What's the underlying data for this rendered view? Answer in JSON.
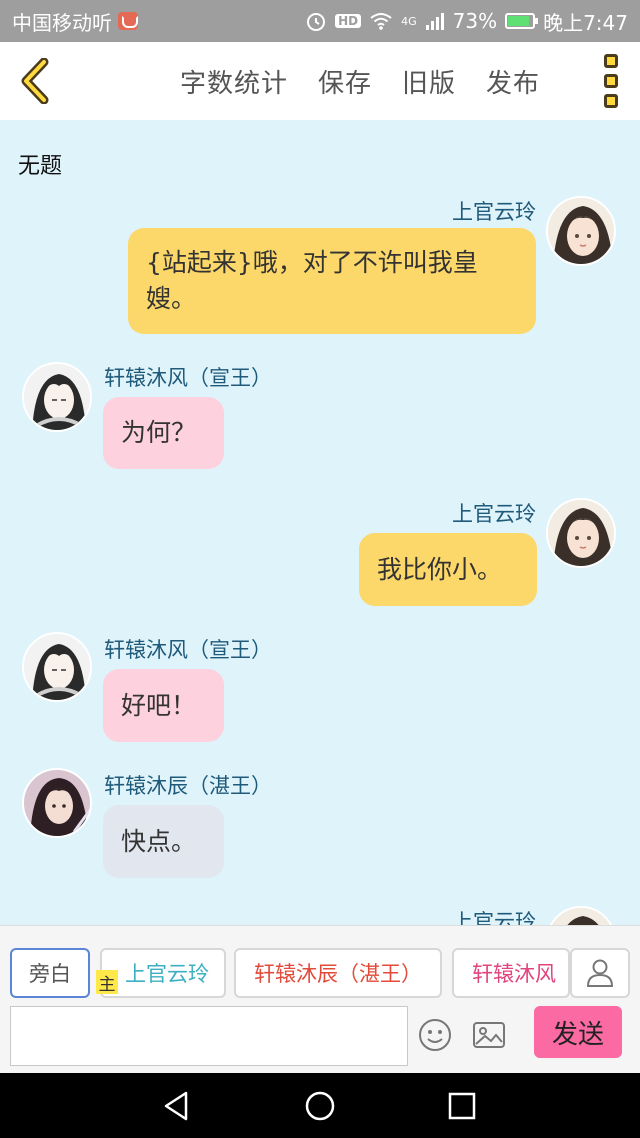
{
  "status_bar": {
    "carrier": "中国移动听",
    "hd": "HD",
    "network": "4G",
    "battery": "73%",
    "time": "晚上7:47"
  },
  "nav": {
    "items": [
      "字数统计",
      "保存",
      "旧版",
      "发布"
    ]
  },
  "chat": {
    "title": "无题",
    "messages": [
      {
        "speaker": "上官云玲",
        "text": "{站起来}哦，对了不许叫我皇嫂。"
      },
      {
        "speaker": "轩辕沐风（宣王）",
        "text": "为何？"
      },
      {
        "speaker": "上官云玲",
        "text": "我比你小。"
      },
      {
        "speaker": "轩辕沐风（宣王）",
        "text": "好吧！"
      },
      {
        "speaker": "轩辕沐辰（湛王）",
        "text": "快点。"
      },
      {
        "speaker": "上官云玲",
        "text": ""
      }
    ]
  },
  "roles": {
    "narration": "旁白",
    "main_tag": "主",
    "items": [
      "上官云玲",
      "轩辕沐辰（湛王）",
      "轩辕沐风"
    ]
  },
  "composer": {
    "input_value": "",
    "send_label": "发送"
  },
  "icons": {
    "back": "chevron-left-icon",
    "more": "more-vertical-icon",
    "person": "person-icon",
    "emoji": "smiley-icon",
    "image": "image-icon"
  },
  "colors": {
    "chat_background": "#dff3fb",
    "bubble_self": "#fcd769",
    "bubble_xuan": "#fdd1dd",
    "bubble_zhan": "#e1e6ef",
    "send": "#fb6aa2"
  }
}
